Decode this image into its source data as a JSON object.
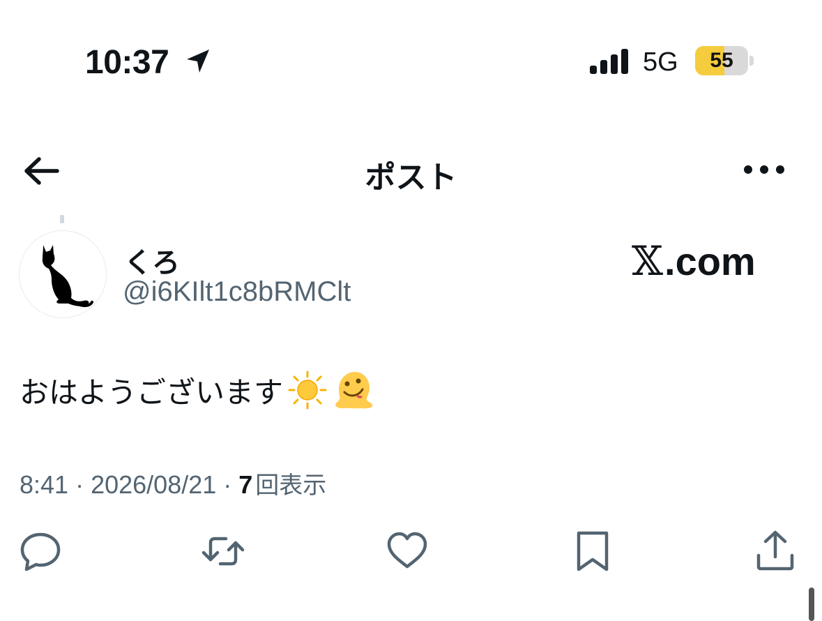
{
  "status_bar": {
    "time": "10:37",
    "network": "5G",
    "battery_level": "55",
    "battery_fraction": 0.55,
    "icons": [
      "location-arrow-icon",
      "cellular-signal-icon",
      "battery-icon"
    ]
  },
  "nav": {
    "title": "ポスト",
    "icons": [
      "back-arrow-icon",
      "more-options-icon"
    ]
  },
  "post": {
    "display_name": "くろ",
    "handle": "@i6KIlt1c8bRMClt",
    "watermark_x": "𝕏",
    "watermark_rest": ".com",
    "text": "おはようございます",
    "emojis": [
      "sun-emoji",
      "melting-face-emoji"
    ],
    "time": "8:41",
    "separator": "·",
    "date": "2026/08/21",
    "views_count": "7",
    "views_label": "回表示"
  },
  "actions": [
    "reply-icon",
    "repost-icon",
    "like-icon",
    "bookmark-icon",
    "share-icon"
  ],
  "colors": {
    "text_primary": "#0f1419",
    "text_secondary": "#536471",
    "battery_fill": "#f5cc3d",
    "icon_gray": "#536471"
  }
}
